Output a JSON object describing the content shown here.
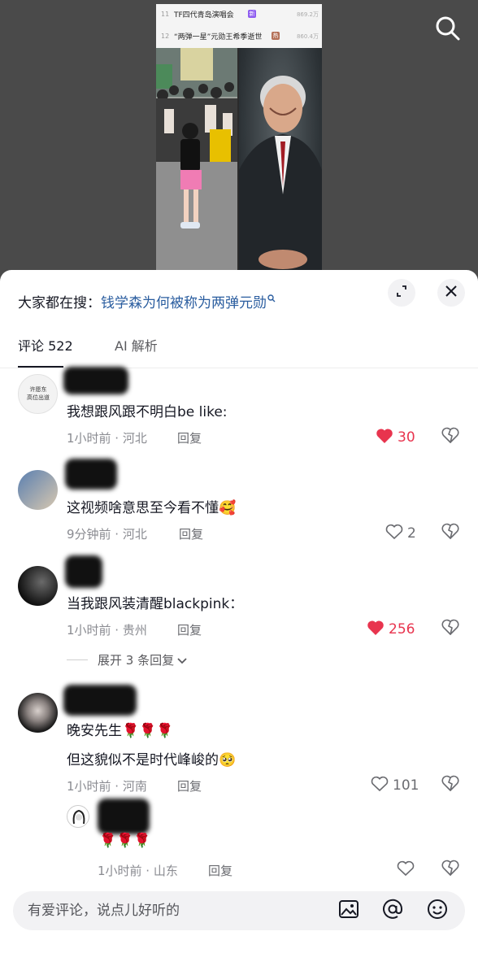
{
  "trending": [
    {
      "rank": "11",
      "title": "TF四代青岛演唱会",
      "badge": "新",
      "badge_color": "#8e5cf0",
      "count": "869.2万"
    },
    {
      "rank": "12",
      "title": "“两弹一星”元勋王希季逝世",
      "badge": "热",
      "badge_color": "#b36f56",
      "count": "860.4万"
    }
  ],
  "hot_search": {
    "prefix": "大家都在搜：",
    "query": "钱学森为何被称为两弹元勋"
  },
  "tabs": {
    "comments": "评论 522",
    "ai": "AI 解析"
  },
  "comments": [
    {
      "text": "我想跟风跟不明白be like:",
      "time": "1小时前 · 河北",
      "reply": "回复",
      "likes": "30",
      "liked": true
    },
    {
      "text": "这视频啥意思至今看不懂🥰",
      "time": "9分钟前 · 河北",
      "reply": "回复",
      "likes": "2",
      "liked": false
    },
    {
      "text": "当我跟风装清醒blackpink：",
      "time": "1小时前 · 贵州",
      "reply": "回复",
      "likes": "256",
      "liked": true,
      "expand": "展开 3 条回复"
    },
    {
      "text": "晚安先生🌹🌹🌹",
      "text2": "但这貌似不是时代峰峻的🥺",
      "time": "1小时前 · 河南",
      "reply": "回复",
      "likes": "101",
      "liked": false
    }
  ],
  "sub_reply": {
    "text": "🌹🌹🌹",
    "time": "1小时前 · 山东",
    "reply": "回复"
  },
  "input": {
    "placeholder": "有爱评论，说点儿好听的"
  },
  "avatar1_text": "许愿东\n高位出道",
  "colors": {
    "accent_link": "#2a5d9f",
    "like_red": "#e8344e"
  }
}
